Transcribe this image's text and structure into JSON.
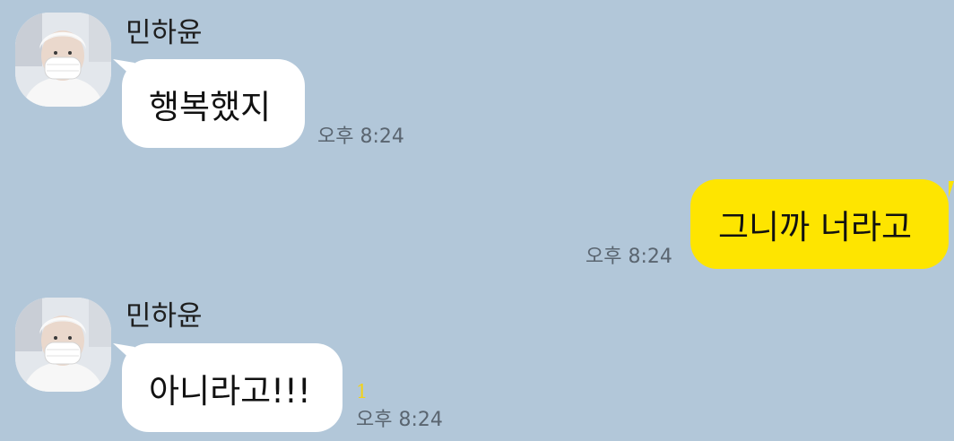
{
  "messages": [
    {
      "direction": "received",
      "sender": "민하윤",
      "text": "행복했지",
      "time": "오후 8:24"
    },
    {
      "direction": "sent",
      "text": "그니까 너라고",
      "time": "오후 8:24"
    },
    {
      "direction": "received",
      "sender": "민하윤",
      "text": "아니라고!!!",
      "time": "오후 8:24",
      "unread_count": "1"
    }
  ],
  "colors": {
    "chat_background": "#b2c7d9",
    "received_bubble": "#ffffff",
    "sent_bubble": "#fee500",
    "unread_count": "#f2d21a",
    "time_text": "#5a6570"
  },
  "icons": {
    "avatar": "profile-photo-person-in-mask"
  }
}
